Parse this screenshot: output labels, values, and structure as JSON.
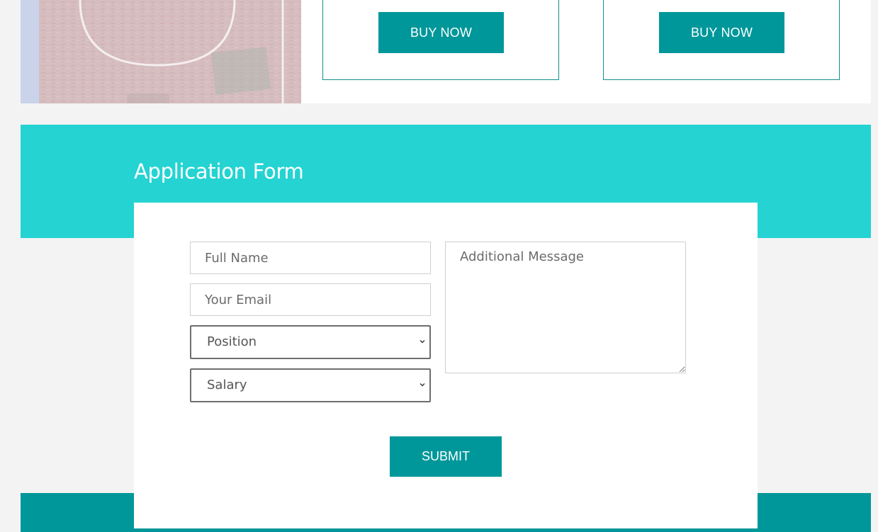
{
  "products": {
    "image": "basketball-court-image",
    "cards": [
      {
        "button_label": "BUY NOW"
      },
      {
        "button_label": "BUY NOW"
      }
    ]
  },
  "form": {
    "title": "Application Form",
    "full_name_placeholder": "Full Name",
    "email_placeholder": "Your Email",
    "position_value": "Position",
    "salary_value": "Salary",
    "message_placeholder": "Additional Message",
    "submit_label": "SUBMIT"
  },
  "colors": {
    "accent": "#00979a",
    "band": "#25d3d3",
    "page_background": "#f3f3f3"
  }
}
